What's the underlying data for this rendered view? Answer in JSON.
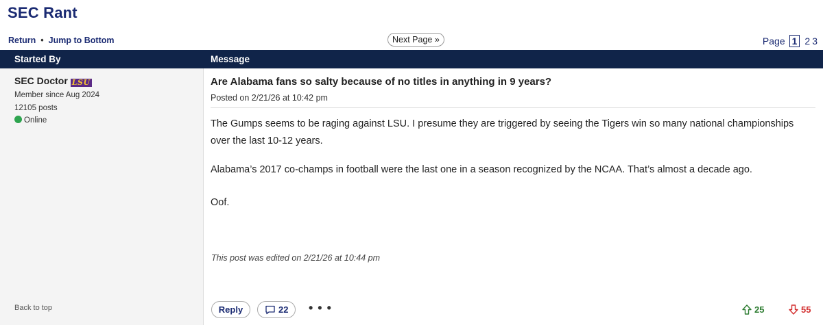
{
  "board": {
    "title": "SEC Rant"
  },
  "nav": {
    "return_label": "Return",
    "separator": "•",
    "jump_label": "Jump to Bottom",
    "next_page_label": "Next Page »",
    "page_label": "Page",
    "current_page": "1",
    "pages": [
      "2",
      "3"
    ]
  },
  "columns": {
    "started_by": "Started By",
    "message": "Message"
  },
  "author": {
    "name": "SEC Doctor",
    "team_logo": "LSU",
    "member_since": "Member since Aug 2024",
    "posts": "12105 posts",
    "status": "Online",
    "back_to_top": "Back to top"
  },
  "post": {
    "subject": "Are Alabama fans so salty because of no titles in anything in 9 years?",
    "posted": "Posted on 2/21/26 at 10:42 pm",
    "paragraphs": [
      "The Gumps seems to be raging against LSU. I presume they are triggered by seeing the Tigers win so many national championships over the last 10-12 years.",
      "Alabama’s 2017 co-champs in football were the last one in a season recognized by the NCAA. That’s almost a decade ago.",
      "Oof."
    ],
    "edited": "This post was edited on 2/21/26 at 10:44 pm"
  },
  "actions": {
    "reply_label": "Reply",
    "comment_count": "22",
    "more": "• • •",
    "upvotes": "25",
    "downvotes": "55"
  },
  "colors": {
    "brand_navy": "#102449",
    "link": "#1a2a72",
    "online": "#2ea44f",
    "upvote": "#2e7d32",
    "downvote": "#d32f2f"
  },
  "icons": [
    "comment-bubble-icon",
    "thumbs-up-arrow-icon",
    "thumbs-down-arrow-icon",
    "online-status-icon",
    "lsu-logo"
  ]
}
